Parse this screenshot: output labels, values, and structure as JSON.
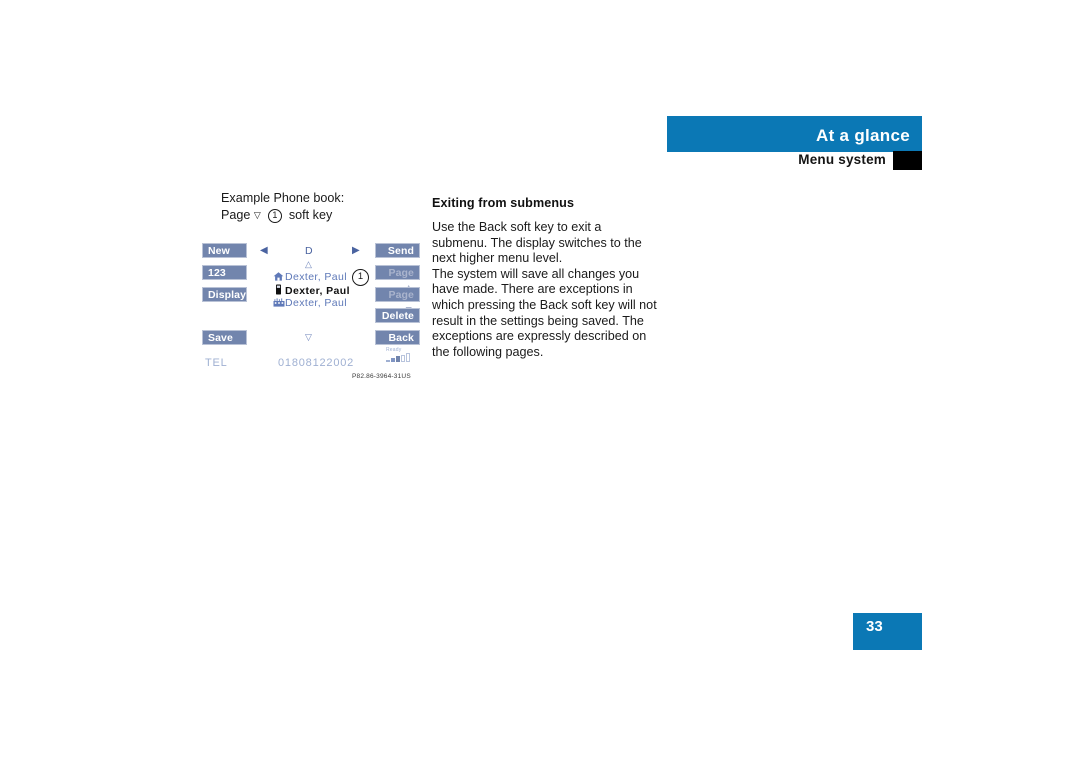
{
  "header": {
    "title": "At a glance",
    "subtitle": "Menu system",
    "accent_color": "#0b78b5",
    "marker_color": "#000000"
  },
  "figure_caption": {
    "line1": "Example Phone book:",
    "line2_prefix": "Page",
    "line2_symbol": "▽",
    "line2_ref": "1",
    "line2_suffix": "soft key"
  },
  "phone_figure": {
    "left_softkeys": [
      {
        "label": "New",
        "dim": false
      },
      {
        "label": "123",
        "dim": false
      },
      {
        "label": "Display",
        "dim": false
      },
      {
        "label": "Save",
        "dim": false
      }
    ],
    "right_softkeys": [
      {
        "label": "Send",
        "dim": false
      },
      {
        "label": "Page ▲",
        "dim": true
      },
      {
        "label": "Page ▼",
        "dim": true
      },
      {
        "label": "Delete",
        "dim": false
      },
      {
        "label": "Back",
        "dim": false
      }
    ],
    "nav_left_arrow": "◀",
    "nav_right_arrow": "▶",
    "display_letter": "D",
    "scroll_up": "△",
    "scroll_down": "▽",
    "entries": [
      {
        "icon": "home-icon",
        "glyph": "⌂",
        "name": "Dexter, Paul",
        "selected": false
      },
      {
        "icon": "mobile-phone-icon",
        "glyph": "▐",
        "name": "Dexter, Paul",
        "selected": true
      },
      {
        "icon": "office-building-icon",
        "glyph": "☷",
        "name": "Dexter, Paul",
        "selected": false
      }
    ],
    "callout_marker": "1",
    "status_bar": {
      "network_label": "TEL",
      "number": "01808122002",
      "ready_label": "Ready"
    },
    "figure_code": "P82.86-3964-31US",
    "softkey_color": "#7285ad",
    "display_text_color": "#5f79b8"
  },
  "article": {
    "heading": "Exiting from submenus",
    "paragraphs": [
      "Use the Back soft key to exit a submenu. The display switches to the next higher menu level.",
      "The system will save all changes you have made. There are exceptions in which pressing the Back soft key will not result in the settings being saved. The exceptions are expressly described on the following pages."
    ]
  },
  "page_footer": {
    "page_number": "33"
  }
}
